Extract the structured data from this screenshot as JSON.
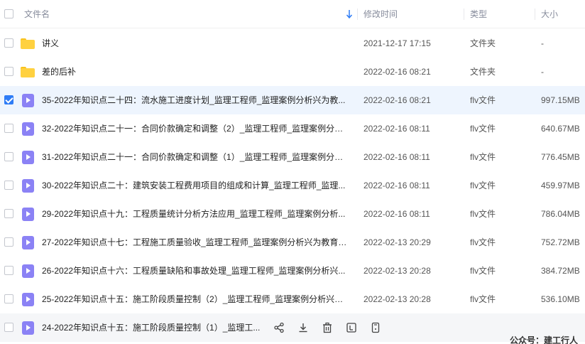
{
  "header": {
    "col_name": "文件名",
    "col_time": "修改时间",
    "col_type": "类型",
    "col_size": "大小"
  },
  "files": [
    {
      "name": "讲义",
      "time": "2021-12-17 17:15",
      "type": "文件夹",
      "size": "-",
      "icon": "folder-icon",
      "checked": false
    },
    {
      "name": "差的后补",
      "time": "2022-02-16 08:21",
      "type": "文件夹",
      "size": "-",
      "icon": "folder-icon",
      "checked": false
    },
    {
      "name": "35-2022年知识点二十四：流水施工进度计划_监理工程师_监理案例分析兴为教...",
      "time": "2022-02-16 08:21",
      "type": "flv文件",
      "size": "997.15MB",
      "icon": "video-file-icon",
      "checked": true
    },
    {
      "name": "32-2022年知识点二十一：合同价款确定和调整（2）_监理工程师_监理案例分析...",
      "time": "2022-02-16 08:11",
      "type": "flv文件",
      "size": "640.67MB",
      "icon": "video-file-icon",
      "checked": false
    },
    {
      "name": "31-2022年知识点二十一：合同价款确定和调整（1）_监理工程师_监理案例分析...",
      "time": "2022-02-16 08:11",
      "type": "flv文件",
      "size": "776.45MB",
      "icon": "video-file-icon",
      "checked": false
    },
    {
      "name": "30-2022年知识点二十：建筑安装工程费用项目的组成和计算_监理工程师_监理...",
      "time": "2022-02-16 08:11",
      "type": "flv文件",
      "size": "459.97MB",
      "icon": "video-file-icon",
      "checked": false
    },
    {
      "name": "29-2022年知识点十九：工程质量统计分析方法应用_监理工程师_监理案例分析...",
      "time": "2022-02-16 08:11",
      "type": "flv文件",
      "size": "786.04MB",
      "icon": "video-file-icon",
      "checked": false
    },
    {
      "name": "27-2022年知识点十七：工程施工质量验收_监理工程师_监理案例分析兴为教育.flv",
      "time": "2022-02-13 20:29",
      "type": "flv文件",
      "size": "752.72MB",
      "icon": "video-file-icon",
      "checked": false
    },
    {
      "name": "26-2022年知识点十六：工程质量缺陷和事故处理_监理工程师_监理案例分析兴...",
      "time": "2022-02-13 20:28",
      "type": "flv文件",
      "size": "384.72MB",
      "icon": "video-file-icon",
      "checked": false
    },
    {
      "name": "25-2022年知识点十五：施工阶段质量控制（2）_监理工程师_监理案例分析兴为...",
      "time": "2022-02-13 20:28",
      "type": "flv文件",
      "size": "536.10MB",
      "icon": "video-file-icon",
      "checked": false
    },
    {
      "name": "24-2022年知识点十五：施工阶段质量控制（1）_监理工...",
      "time": "",
      "type": "",
      "size": "",
      "icon": "video-file-icon",
      "checked": false,
      "hover": true
    }
  ],
  "hover_actions": [
    "share-icon",
    "download-icon",
    "delete-icon",
    "rename-icon",
    "more-icon"
  ],
  "watermark": "公众号：建工行人",
  "colors": {
    "accent": "#2e7cf6",
    "selected_row": "#eef5fe",
    "folder": "#ffd140",
    "video": "#8b82f5"
  }
}
